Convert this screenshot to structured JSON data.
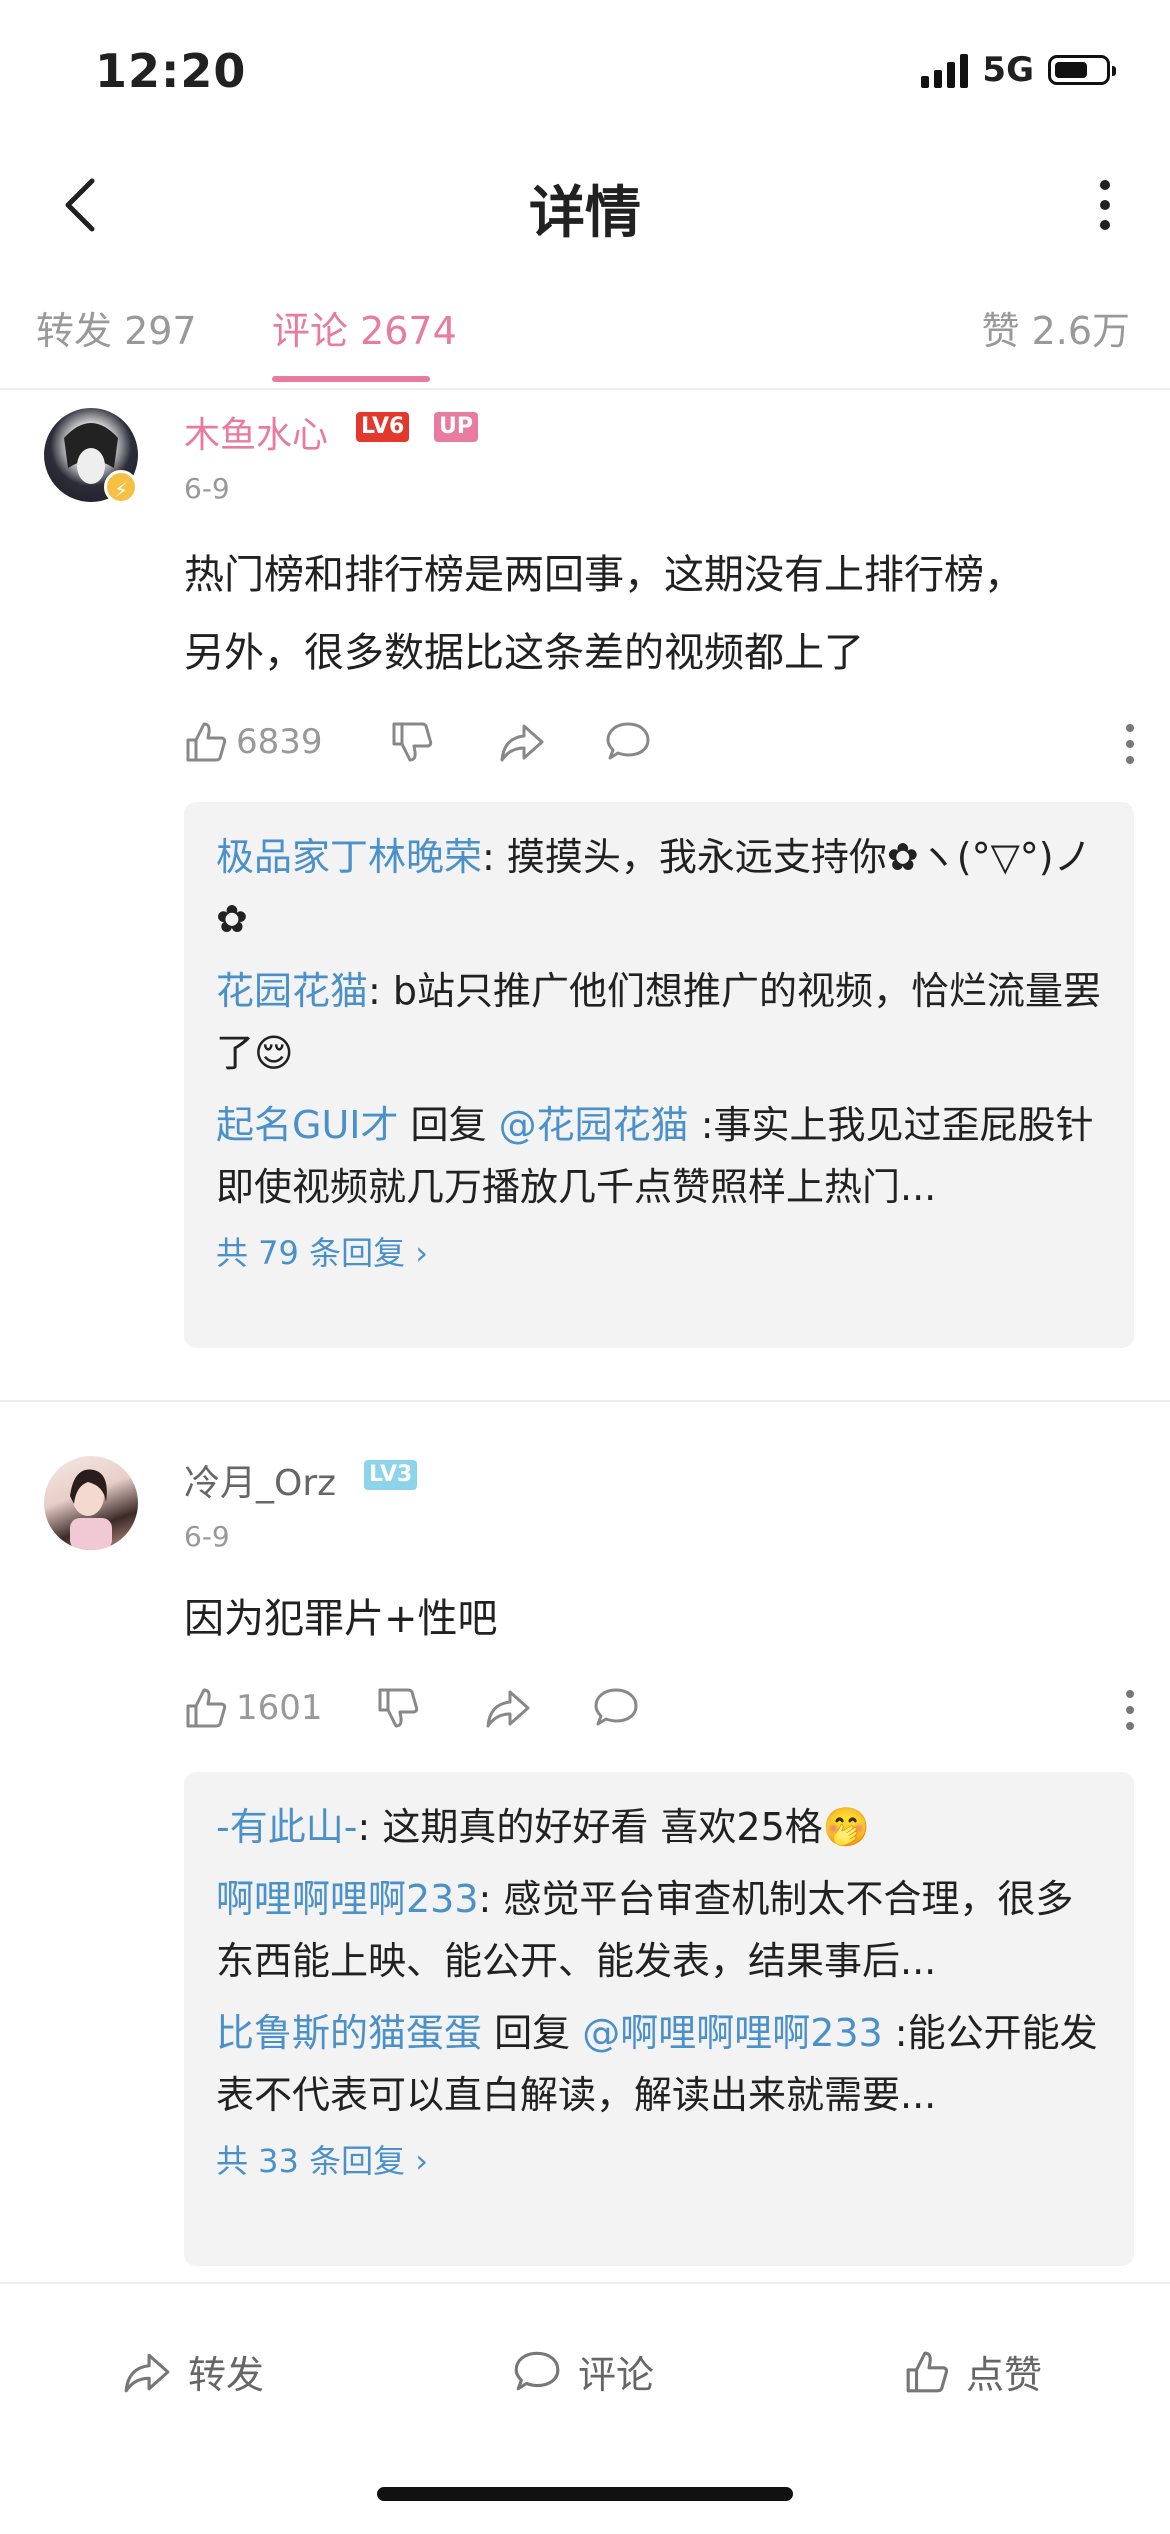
{
  "status_bar": {
    "time": "12:20",
    "network": "5G"
  },
  "nav": {
    "title": "详情"
  },
  "tabs": [
    {
      "label": "转发 297"
    },
    {
      "label": "评论 2674"
    },
    {
      "label": "赞 2.6万"
    }
  ],
  "comments": [
    {
      "username": "木鱼水心",
      "level": "LV6",
      "up_badge": "UP",
      "date": "6-9",
      "text_line1": "热门榜和排行榜是两回事，这期没有上排行榜，",
      "text_line2": "另外，很多数据比这条差的视频都上了",
      "likes": "6839",
      "replies": [
        {
          "name": "极品家丁林晚荣",
          "text": ": 摸摸头，我永远支持你✿ヽ(°▽°)ノ✿"
        },
        {
          "name": "花园花猫",
          "text": ": b站只推广他们想推广的视频，恰烂流量罢了😌"
        },
        {
          "name": "起名GUI才",
          "reply_word": " 回复 ",
          "target": "@花园花猫",
          "text": " :事实上我见过歪屁股针即使视频就几万播放几千点赞照样上热门..."
        }
      ],
      "more_replies": "共 79 条回复 ›"
    },
    {
      "username": "冷月_Orz",
      "level": "LV3",
      "date": "6-9",
      "text_line1": "因为犯罪片+性吧",
      "likes": "1601",
      "replies": [
        {
          "name": "-有此山-",
          "text": ": 这期真的好好看 喜欢25格🤭"
        },
        {
          "name": "啊哩啊哩啊233",
          "text": ": 感觉平台审查机制太不合理，很多东西能上映、能公开、能发表，结果事后..."
        },
        {
          "name": "比鲁斯的猫蛋蛋",
          "reply_word": " 回复 ",
          "target": "@啊哩啊哩啊233",
          "text": " :能公开能发表不代表可以直白解读，解读出来就需要..."
        }
      ],
      "more_replies": "共 33 条回复 ›"
    }
  ],
  "bottom_bar": {
    "repost": "转发",
    "comment": "评论",
    "like": "点赞"
  },
  "colors": {
    "accent": "#e97ba1",
    "link": "#4a90c9",
    "lv6": "#e5382d",
    "lv3": "#8dd3ea"
  }
}
